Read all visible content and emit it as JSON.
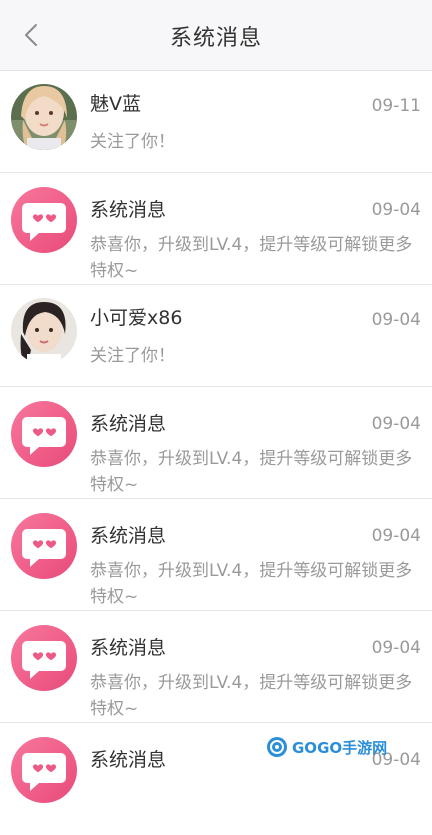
{
  "header": {
    "title": "系统消息",
    "back_icon": "chevron-left-icon"
  },
  "messages": [
    {
      "name": "魅V蓝",
      "date": "09-11",
      "text": "关注了你！",
      "avatar": "photo"
    },
    {
      "name": "系统消息",
      "date": "09-04",
      "text": "恭喜你，升级到LV.4，提升等级可解锁更多特权~",
      "avatar": "system-heart-chat-icon"
    },
    {
      "name": "小可爱x86",
      "date": "09-04",
      "text": "关注了你！",
      "avatar": "photo"
    },
    {
      "name": "系统消息",
      "date": "09-04",
      "text": "恭喜你，升级到LV.4，提升等级可解锁更多特权~",
      "avatar": "system-heart-chat-icon"
    },
    {
      "name": "系统消息",
      "date": "09-04",
      "text": "恭喜你，升级到LV.4，提升等级可解锁更多特权~",
      "avatar": "system-heart-chat-icon"
    },
    {
      "name": "系统消息",
      "date": "09-04",
      "text": "恭喜你，升级到LV.4，提升等级可解锁更多特权~",
      "avatar": "system-heart-chat-icon"
    },
    {
      "name": "系统消息",
      "date": "09-04",
      "text": "",
      "avatar": "system-heart-chat-icon"
    }
  ],
  "watermark": {
    "text": "GOGO手游网"
  },
  "colors": {
    "accent": "#f06089",
    "text_primary": "#333333",
    "text_secondary": "#9a9a9a",
    "header_bg": "#f7f7f9"
  }
}
